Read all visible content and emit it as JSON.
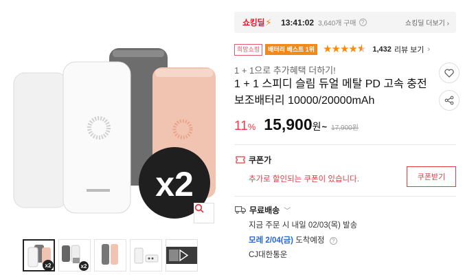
{
  "gallery": {
    "main_overlay_text": "x2",
    "product_brand": "SPEEDY",
    "thumb_overlay": "x2",
    "thumbnails": [
      "thumb-1",
      "thumb-2",
      "thumb-3",
      "thumb-4",
      "thumb-5-video"
    ]
  },
  "deal": {
    "logo": "쇼킹딜",
    "time": "13:41:02",
    "buy_count": "3,640개 구매",
    "more_link": "쇼킹딜 더보기"
  },
  "badges": {
    "store": "희망쇼핑",
    "best": "배터리 베스트 1위",
    "rating": 4.5
  },
  "reviews": {
    "count": "1,432",
    "link": "리뷰 보기"
  },
  "product": {
    "subtitle": "1 + 1으로 추가혜택 더하기!",
    "title": "1 + 1 스피디 슬림 듀얼 메탈 PD 고속 충전 보조배터리 10000/20000mAh"
  },
  "price": {
    "discount": "11",
    "discount_unit": "%",
    "sale": "15,900",
    "won": "원",
    "tilde": "~",
    "original": "17,900원"
  },
  "coupon": {
    "label": "쿠폰가",
    "message": "추가로 할인되는 쿠폰이 있습니다.",
    "button": "쿠폰받기"
  },
  "shipping": {
    "label": "무료배송",
    "line1": "지금 주문 시 내일 02/03(목) 발송",
    "date": "모레 2/04(금)",
    "arrival": "도착예정",
    "carrier": "CJ대한통운"
  },
  "colors": {
    "accent_red": "#e23b45",
    "deal_red": "#e8142a",
    "best_orange": "#f08a1c",
    "star_orange": "#ff8a00",
    "date_blue": "#2a66d4"
  },
  "icons": [
    "search-icon",
    "heart-icon",
    "share-icon",
    "coupon-icon",
    "truck-icon",
    "help-icon",
    "chevron-right-icon",
    "chevron-down-icon",
    "play-icon"
  ]
}
